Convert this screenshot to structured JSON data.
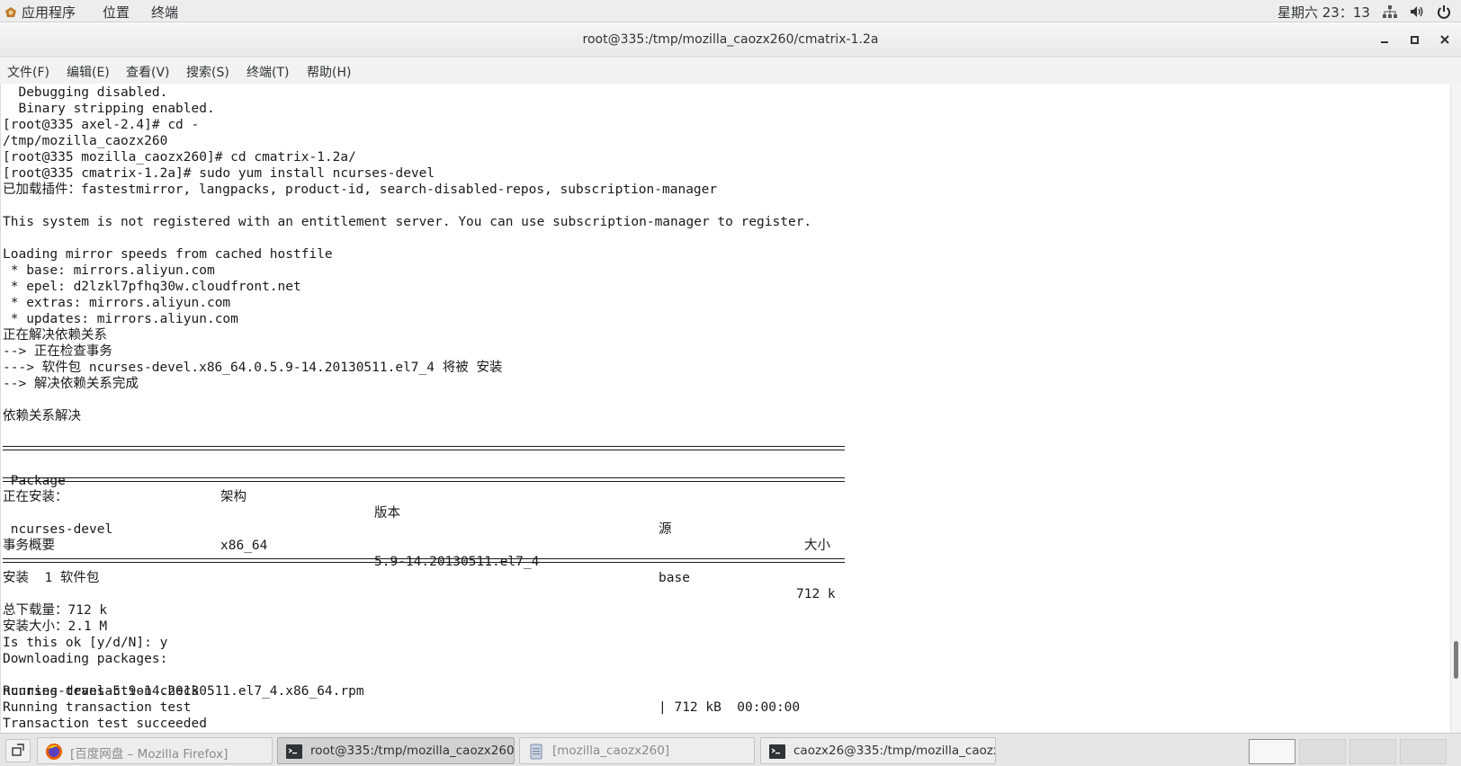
{
  "top_panel": {
    "apps_label": "应用程序",
    "places_label": "位置",
    "terminal_label": "终端",
    "clock": "星期六 23：13",
    "icons": [
      "network-icon",
      "volume-icon",
      "power-icon"
    ]
  },
  "window": {
    "title": "root@335:/tmp/mozilla_caozx260/cmatrix-1.2a",
    "buttons": [
      "minimize",
      "maximize",
      "close"
    ]
  },
  "menubar": {
    "items": [
      "文件(F)",
      "编辑(E)",
      "查看(V)",
      "搜索(S)",
      "终端(T)",
      "帮助(H)"
    ]
  },
  "terminal": {
    "lines_top": [
      "  Debugging disabled.",
      "  Binary stripping enabled.",
      "[root@335 axel-2.4]# cd -",
      "/tmp/mozilla_caozx260",
      "[root@335 mozilla_caozx260]# cd cmatrix-1.2a/",
      "[root@335 cmatrix-1.2a]# sudo yum install ncurses-devel",
      "已加载插件：fastestmirror, langpacks, product-id, search-disabled-repos, subscription-manager",
      "",
      "This system is not registered with an entitlement server. You can use subscription-manager to register.",
      "",
      "Loading mirror speeds from cached hostfile",
      " * base: mirrors.aliyun.com",
      " * epel: d2lzkl7pfhq30w.cloudfront.net",
      " * extras: mirrors.aliyun.com",
      " * updates: mirrors.aliyun.com",
      "正在解决依赖关系",
      "--> 正在检查事务",
      "---> 软件包 ncurses-devel.x86_64.0.5.9-14.20130511.el7_4 将被 安装",
      "--> 解决依赖关系完成",
      "",
      "依赖关系解决",
      ""
    ],
    "table_header": {
      "package": " Package",
      "arch": "架构",
      "version": "版本",
      "repo": "源",
      "size": "大小"
    },
    "installing_label": "正在安装：",
    "table_row": {
      "package": " ncurses-devel",
      "arch": "x86_64",
      "version": "5.9-14.20130511.el7_4",
      "repo": "base",
      "size": "712 k"
    },
    "summary_label": "事务概要",
    "lines_bottom": [
      "安装  1 软件包",
      "",
      "总下载量：712 k",
      "安装大小：2.1 M",
      "Is this ok [y/d/N]: y",
      "Downloading packages:"
    ],
    "download_line": {
      "file": "ncurses-devel-5.9-14.20130511.el7_4.x86_64.rpm",
      "stats": "| 712 kB  00:00:00"
    },
    "lines_end": [
      "Running transaction check",
      "Running transaction test",
      "Transaction test succeeded"
    ]
  },
  "taskbar": {
    "tasks": [
      {
        "label": "[百度网盘 – Mozilla Firefox]",
        "icon": "firefox-icon"
      },
      {
        "label": "root@335:/tmp/mozilla_caozx260/···",
        "icon": "terminal-icon"
      },
      {
        "label": "[mozilla_caozx260]",
        "icon": "files-icon"
      },
      {
        "label": "caozx26@335:/tmp/mozilla_caozx···",
        "icon": "terminal-icon"
      }
    ],
    "workspaces": 4,
    "current_workspace": 1
  }
}
